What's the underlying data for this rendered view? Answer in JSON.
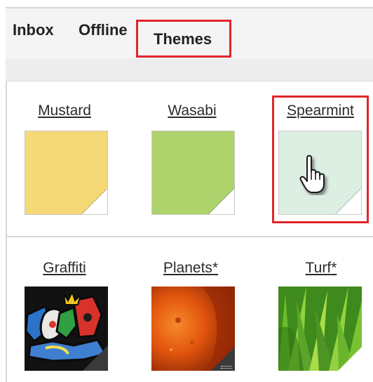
{
  "tabs": {
    "inbox": "Inbox",
    "offline": "Offline",
    "themes": "Themes"
  },
  "themes": [
    {
      "name": "Mustard",
      "suffix": "",
      "color": "#f6d977"
    },
    {
      "name": "Wasabi",
      "suffix": "",
      "color": "#aed36c"
    },
    {
      "name": "Spearmint",
      "suffix": "",
      "color": "#dcefe2"
    },
    {
      "name": "Graffiti",
      "suffix": "",
      "color": "#151515"
    },
    {
      "name": "Planets",
      "suffix": "*",
      "color": "#e0580f"
    },
    {
      "name": "Turf",
      "suffix": "*",
      "color": "#5aa52a"
    }
  ],
  "selected_theme": "Spearmint",
  "accent_color": "#e0262a"
}
